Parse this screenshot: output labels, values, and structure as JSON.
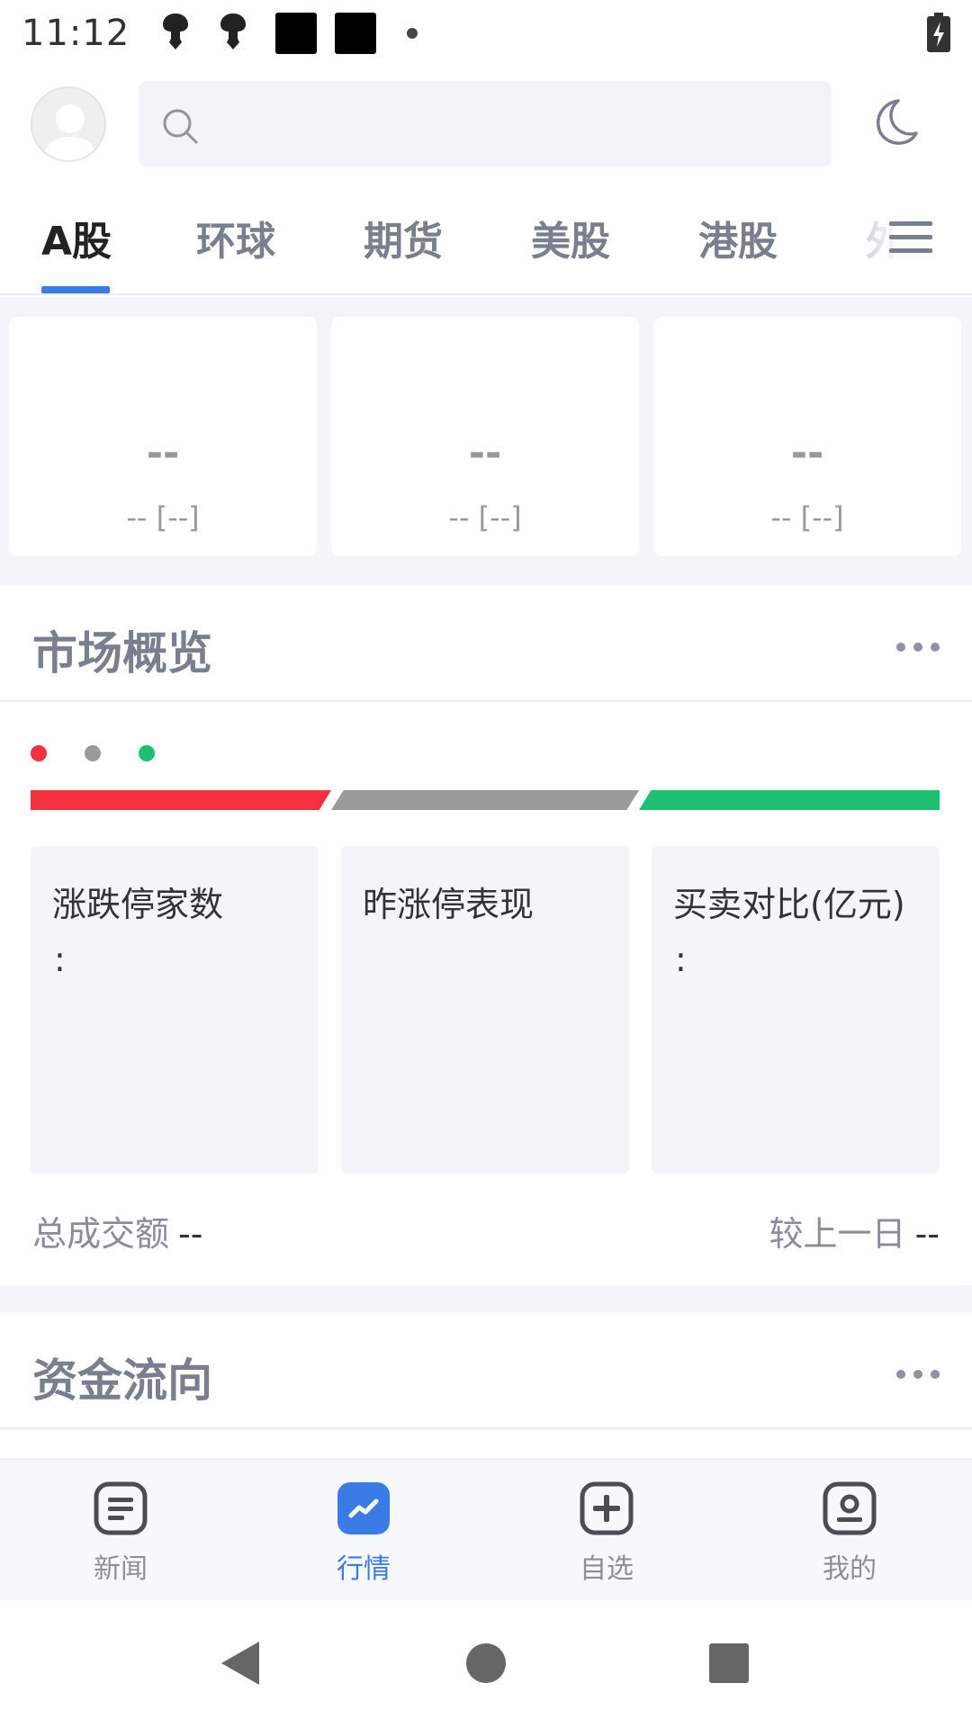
{
  "status_bar": {
    "time": "11:12"
  },
  "tabs": [
    {
      "label": "A股",
      "active": true
    },
    {
      "label": "环球",
      "active": false
    },
    {
      "label": "期货",
      "active": false
    },
    {
      "label": "美股",
      "active": false
    },
    {
      "label": "港股",
      "active": false
    },
    {
      "label": "外",
      "active": false
    }
  ],
  "index_cards": [
    {
      "value": "--",
      "change": "-- [--]"
    },
    {
      "value": "--",
      "change": "-- [--]"
    },
    {
      "value": "--",
      "change": "-- [--]"
    }
  ],
  "market_overview": {
    "title": "市场概览",
    "stats": [
      {
        "title": "涨跌停家数",
        "value": ":"
      },
      {
        "title": "昨涨停表现",
        "value": ""
      },
      {
        "title": "买卖对比(亿元)",
        "value": ":"
      }
    ],
    "total_label": "总成交额",
    "total_value": "--",
    "prev_label": "较上一日",
    "prev_value": "--",
    "colors": {
      "up": "#f5303f",
      "flat": "#9a9a9a",
      "down": "#1dbf73"
    }
  },
  "fund_flow": {
    "title": "资金流向"
  },
  "bottom_nav": [
    {
      "label": "新闻",
      "icon": "news-icon",
      "active": false
    },
    {
      "label": "行情",
      "icon": "market-chart-icon",
      "active": true
    },
    {
      "label": "自选",
      "icon": "add-watchlist-icon",
      "active": false
    },
    {
      "label": "我的",
      "icon": "profile-icon",
      "active": false
    }
  ],
  "accent_color": "#3b7be8"
}
